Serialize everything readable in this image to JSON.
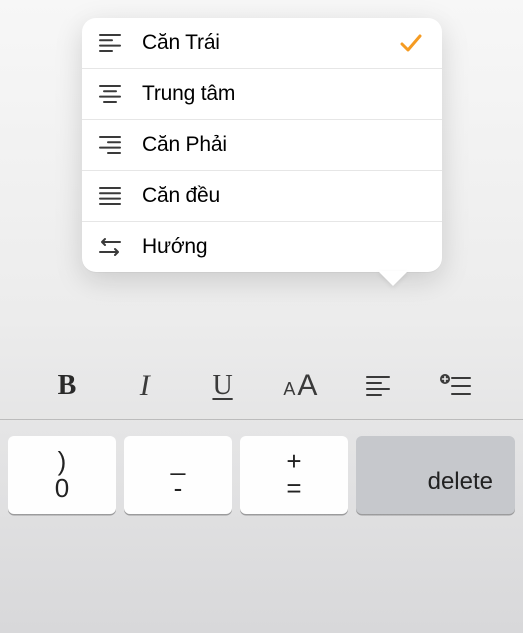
{
  "menu": {
    "items": [
      {
        "label": "Căn Trái",
        "selected": true
      },
      {
        "label": "Trung tâm",
        "selected": false
      },
      {
        "label": "Căn Phải",
        "selected": false
      },
      {
        "label": "Căn đều",
        "selected": false
      },
      {
        "label": "Hướng",
        "selected": false
      }
    ]
  },
  "toolbar": {
    "bold": "B",
    "italic": "I",
    "underline": "U"
  },
  "keyboard": {
    "key1_top": ")",
    "key1_bot": "0",
    "key2_top": "_",
    "key2_bot": "-",
    "key3_top": "+",
    "key3_bot": "=",
    "delete_label": "delete"
  },
  "colors": {
    "accent": "#f59b22"
  }
}
